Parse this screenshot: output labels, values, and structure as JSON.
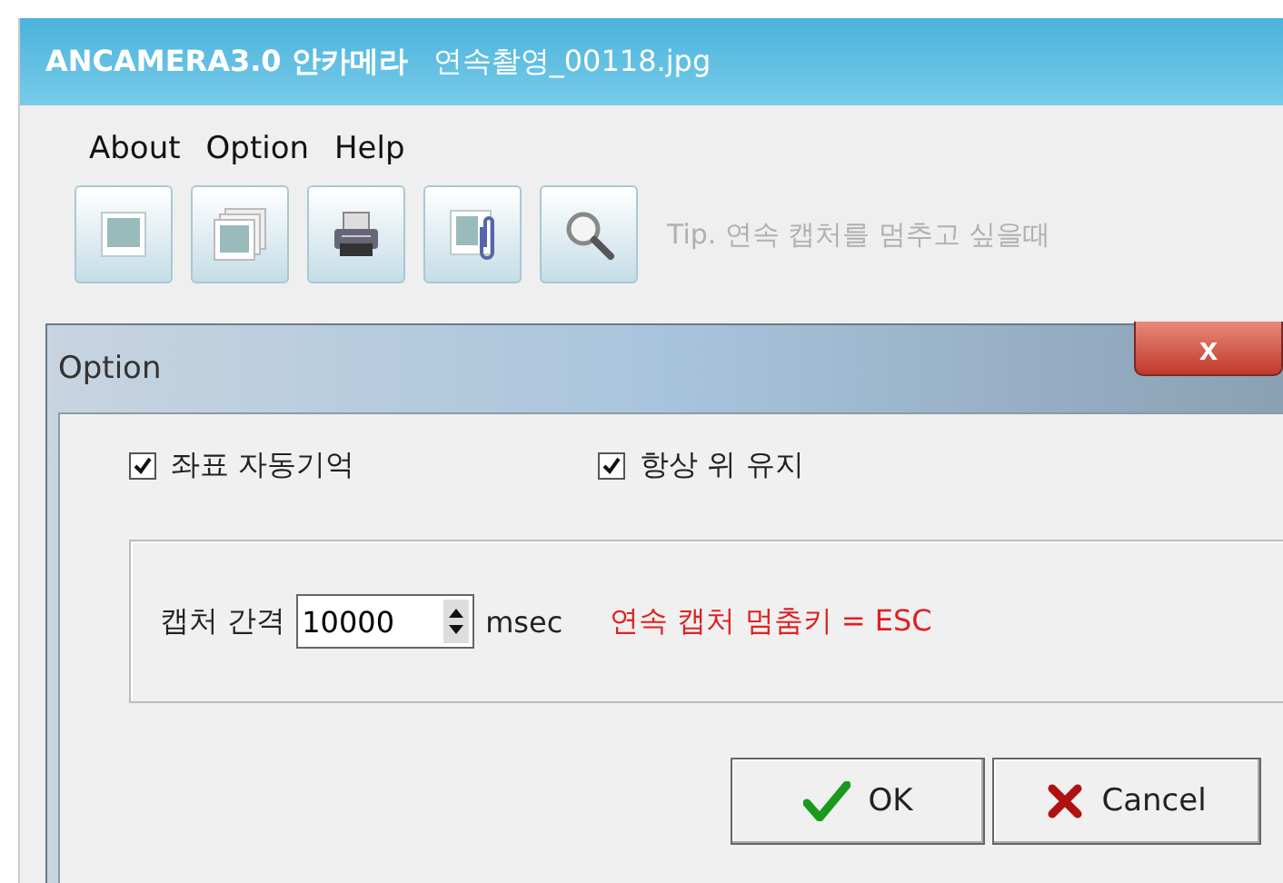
{
  "window": {
    "title": "ANCAMERA3.0 안카메라",
    "file": "연속촬영_00118.jpg"
  },
  "menu": [
    "About",
    "Option",
    "Help"
  ],
  "toolbar": {
    "buttons": [
      {
        "kind": "frame"
      },
      {
        "kind": "stack"
      },
      {
        "kind": "printer"
      },
      {
        "kind": "clip"
      },
      {
        "kind": "magnifier"
      }
    ],
    "tip": "Tip. 연속 캡처를 멈추고 싶을때"
  },
  "dialog": {
    "title": "Option",
    "close": "x",
    "checkboxes": [
      {
        "label": "좌표 자동기억",
        "checked": true
      },
      {
        "label": "항상 위 유지",
        "checked": true
      }
    ],
    "interval": {
      "label": "캡처 간격",
      "value": "10000",
      "unit": "msec",
      "note": "연속 캡처 멈춤키 = ESC"
    },
    "buttons": [
      {
        "kind": "ok",
        "label": "OK"
      },
      {
        "kind": "cancel",
        "label": "Cancel"
      }
    ]
  }
}
